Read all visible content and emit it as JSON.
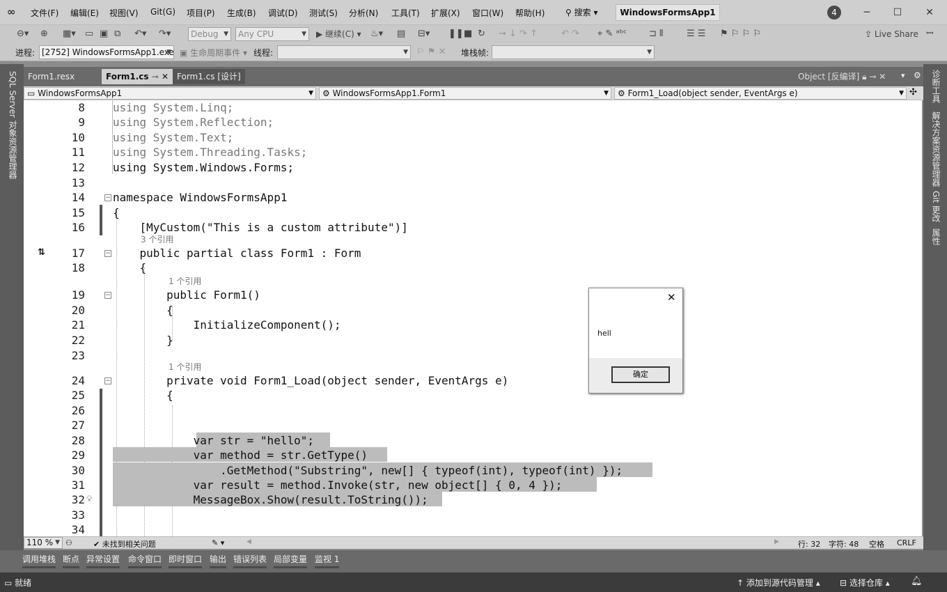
{
  "title_bar": {
    "menus": [
      "文件(F)",
      "编辑(E)",
      "视图(V)",
      "Git(G)",
      "项目(P)",
      "生成(B)",
      "调试(D)",
      "测试(S)",
      "分析(N)",
      "工具(T)",
      "扩展(X)",
      "窗口(W)",
      "帮助(H)"
    ],
    "search_label": "搜索",
    "app_title": "WindowsFormsApp1",
    "badge": "4"
  },
  "toolbar": {
    "config": "Debug",
    "platform": "Any CPU",
    "continue_label": "继续(C)",
    "live_share": "Live Share"
  },
  "toolbar2": {
    "process_label": "进程:",
    "process_value": "[2752] WindowsFormsApp1.exe",
    "lifecycle_label": "生命周期事件",
    "thread_label": "线程:",
    "stackframe_label": "堆栈帧:"
  },
  "left_panel": {
    "label": "SQL Server 对象资源管理器"
  },
  "right_panel": {
    "items": [
      "诊断工具",
      "解决方案资源管理器",
      "Git 更改",
      "属性"
    ]
  },
  "tabs": [
    {
      "label": "Form1.resx"
    },
    {
      "label": "Form1.cs"
    },
    {
      "label": "Form1.cs [设计]"
    }
  ],
  "object_tab": "Object [反编译]",
  "nav": {
    "project": "WindowsFormsApp1",
    "class": "WindowsFormsApp1.Form1",
    "member": "Form1_Load(object sender, EventArgs e)"
  },
  "code": [
    {
      "n": "8",
      "t": "using System.Linq;"
    },
    {
      "n": "9",
      "t": "using System.Reflection;"
    },
    {
      "n": "10",
      "t": "using System.Text;"
    },
    {
      "n": "11",
      "t": "using System.Threading.Tasks;"
    },
    {
      "n": "12",
      "t": "using System.Windows.Forms;"
    },
    {
      "n": "13",
      "t": ""
    },
    {
      "n": "14",
      "t": "namespace WindowsFormsApp1"
    },
    {
      "n": "15",
      "t": "{"
    },
    {
      "n": "16",
      "t": "    [MyCustom(\"This is a custom attribute\")]"
    },
    {
      "n": "17",
      "t": "    public partial class Form1 : Form"
    },
    {
      "n": "18",
      "t": "    {"
    },
    {
      "n": "19",
      "t": "        public Form1()"
    },
    {
      "n": "20",
      "t": "        {"
    },
    {
      "n": "21",
      "t": "            InitializeComponent();"
    },
    {
      "n": "22",
      "t": "        }"
    },
    {
      "n": "23",
      "t": ""
    },
    {
      "n": "24",
      "t": "        private void Form1_Load(object sender, EventArgs e)"
    },
    {
      "n": "25",
      "t": "        {"
    },
    {
      "n": "26",
      "t": ""
    },
    {
      "n": "27",
      "t": ""
    },
    {
      "n": "28",
      "t": "            var str = \"hello\";"
    },
    {
      "n": "29",
      "t": "            var method = str.GetType()"
    },
    {
      "n": "30",
      "t": "                .GetMethod(\"Substring\", new[] { typeof(int), typeof(int) });"
    },
    {
      "n": "31",
      "t": "            var result = method.Invoke(str, new object[] { 0, 4 });"
    },
    {
      "n": "32",
      "t": "            MessageBox.Show(result.ToString());"
    },
    {
      "n": "33",
      "t": ""
    },
    {
      "n": "34",
      "t": ""
    }
  ],
  "references": {
    "r17": "3 个引用",
    "r19": "1 个引用",
    "r24": "1 个引用"
  },
  "status_line": {
    "zoom": "110 %",
    "issues": "未找到相关问题",
    "line": "行: 32",
    "char": "字符: 48",
    "space": "空格",
    "eol": "CRLF"
  },
  "bottom_tabs": [
    "调用堆栈",
    "断点",
    "异常设置",
    "命令窗口",
    "即时窗口",
    "输出",
    "错误列表",
    "局部变量",
    "监视 1"
  ],
  "status_bar": {
    "ready": "就绪",
    "add_source": "添加到源代码管理",
    "select_repo": "选择仓库"
  },
  "dialog": {
    "message": "hell",
    "ok": "确定"
  }
}
